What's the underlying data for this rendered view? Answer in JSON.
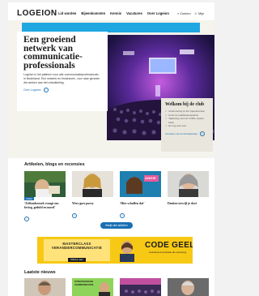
{
  "header": {
    "logo": "LOGEION",
    "nav": [
      "Lid worden",
      "Bijeenkomsten",
      "Kennis",
      "Vacatures",
      "Over Logeion"
    ],
    "search_label": "Zoeken",
    "login_label": "Mijn"
  },
  "hero": {
    "title": "Een groeiend netwerk van communicatie-professionals",
    "text": "Logeion is het platform voor alle communicatieprofessionals in Nederland. Een netwerk en thuishaven, voor naar genoten die werken aan het ontwikkeling.",
    "link_label": "Over Logeion",
    "colors": {
      "band": "#1fa7e2",
      "card_bg": "#f4f3ec"
    }
  },
  "welcome": {
    "title": "Welkom bij de club",
    "items": [
      "Gratis korting op 40+ bijeenkomsten",
      "Korte met vakliteratuurpartner",
      "Vakkorting met ruim 6.000+ andere leden",
      "En nog veel meer"
    ],
    "link_label": "Voordelen van het lidmaatschap"
  },
  "articles": {
    "heading": "Artikelen, blogs en recensies",
    "items": [
      {
        "caption": "‘Zelfonderzoek vraagt ons fovieg, geduld en moed’",
        "tag": "Artikel",
        "photo": "reading-photo"
      },
      {
        "caption": "Wees goes pucey",
        "tag": "",
        "photo": "woman-photo"
      },
      {
        "caption": "‘Hier schaffen dat’",
        "tag": "ANGIE",
        "photo": "angie-photo"
      },
      {
        "caption": "Denken terwijl je doet",
        "tag": "",
        "photo": "gray-hair-photo"
      }
    ],
    "all_button": "Bekijk alle artikelen"
  },
  "banner": {
    "line1": "MASTERCLASS",
    "line2": "VERANDERCOMMUNICATIE",
    "cta": "Meld je aan",
    "title": "CODE GEEL",
    "subtitle": "verandercommunicatie als ontvoering",
    "colors": {
      "bg": "#f7c915"
    }
  },
  "news": {
    "heading": "Laatste nieuws",
    "items": [
      {
        "label": "",
        "photo": "man-photo"
      },
      {
        "label": "STRATEGISCHE COMMUNICATIE",
        "photo": "green-promo"
      },
      {
        "label": "",
        "photo": "event-photo"
      },
      {
        "label": "",
        "photo": "old-man-photo"
      }
    ]
  }
}
